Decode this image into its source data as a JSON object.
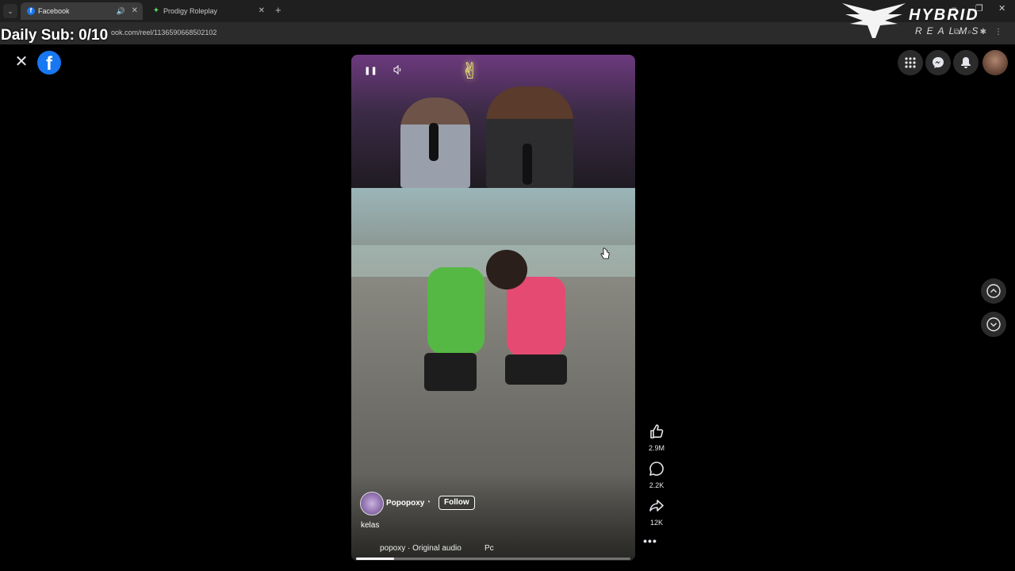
{
  "browser": {
    "tabs": [
      {
        "title": "Facebook",
        "favicon": "facebook-icon",
        "active": true
      },
      {
        "title": "Prodigy Roleplay",
        "favicon": "leaf-icon",
        "active": false
      }
    ],
    "url": "ook.com/reel/1136590668502102"
  },
  "overlay": {
    "title": "Daily Sub: 0/10",
    "watermark": "HYBRID REALMS"
  },
  "facebook": {
    "logo_letter": "f"
  },
  "reel": {
    "author": "Popopoxy",
    "follow_label": "Follow",
    "caption": "kelas",
    "audio_text": "popoxy · Original audio",
    "audio_more": "Pc",
    "progress": 0.14
  },
  "actions": {
    "likes": "2.9M",
    "comments": "2.2K",
    "shares": "12K"
  },
  "colors": {
    "facebook_blue": "#1877f2",
    "background": "#000000"
  }
}
